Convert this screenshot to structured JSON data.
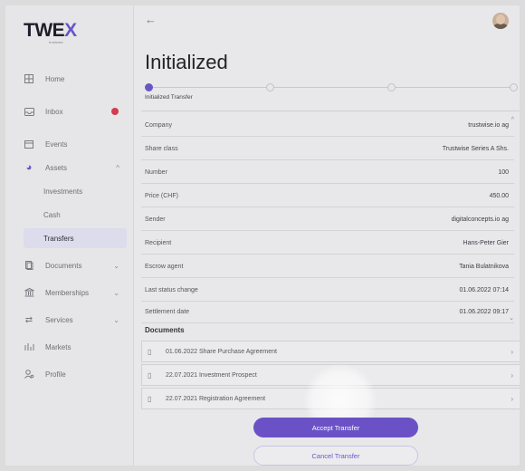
{
  "app": {
    "logo": "TWEX",
    "logo_accent": "X",
    "logo_main": "TWE",
    "logo_sub": "trustwise"
  },
  "colors": {
    "accent": "#6a55c8",
    "badge": "#d43b4e"
  },
  "sidebar": {
    "items": [
      {
        "label": "Home",
        "icon": "home-icon"
      },
      {
        "label": "Inbox",
        "icon": "inbox-icon",
        "badge": true
      },
      {
        "label": "Events",
        "icon": "calendar-icon"
      },
      {
        "label": "Assets",
        "icon": "pie-chart-icon",
        "expanded": true
      },
      {
        "label": "Investments"
      },
      {
        "label": "Cash"
      },
      {
        "label": "Transfers",
        "active": true
      },
      {
        "label": "Documents",
        "icon": "document-icon"
      },
      {
        "label": "Memberships",
        "icon": "bank-icon"
      },
      {
        "label": "Services",
        "icon": "swap-icon"
      },
      {
        "label": "Markets",
        "icon": "markets-icon"
      },
      {
        "label": "Profile",
        "icon": "profile-icon"
      }
    ]
  },
  "main": {
    "title": "Initialized",
    "stepper": {
      "current_label": "Initialized Transfer",
      "current_step": 1,
      "total_steps": 4
    },
    "details": [
      {
        "key": "Company",
        "value": "trustwise.io ag"
      },
      {
        "key": "Share class",
        "value": "Trustwise Series A Shs."
      },
      {
        "key": "Number",
        "value": "100"
      },
      {
        "key": "Price (CHF)",
        "value": "450.00"
      },
      {
        "key": "Sender",
        "value": "digitalconcepts.io ag"
      },
      {
        "key": "Recipient",
        "value": "Hans-Peter Gier"
      },
      {
        "key": "Escrow agent",
        "value": "Tania Bulatnikova"
      },
      {
        "key": "Last status change",
        "value": "01.06.2022 07:14"
      },
      {
        "key": "Settlement date",
        "value": "01.06.2022 09:17"
      }
    ],
    "documents_title": "Documents",
    "documents": [
      "01.06.2022 Share Purchase Agreement",
      "22.07.2021 Investment Prospect",
      "22.07.2021 Registration Agreement"
    ],
    "accept_label": "Accept Transfer",
    "cancel_label": "Cancel Transfer"
  }
}
